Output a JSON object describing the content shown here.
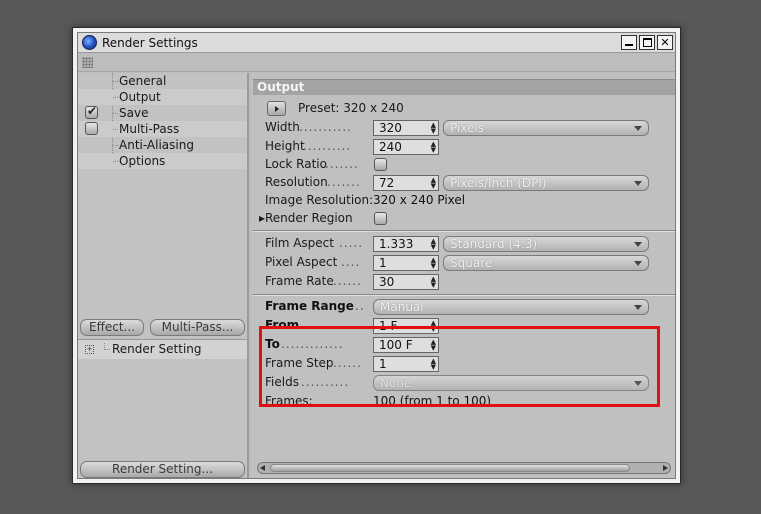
{
  "window": {
    "title": "Render Settings"
  },
  "tree": {
    "items": [
      {
        "label": "General"
      },
      {
        "label": "Output"
      },
      {
        "label": "Save"
      },
      {
        "label": "Multi-Pass"
      },
      {
        "label": "Anti-Aliasing"
      },
      {
        "label": "Options"
      }
    ]
  },
  "left_buttons": {
    "effect": "Effect...",
    "multipass": "Multi-Pass...",
    "render_setting": "Render Setting..."
  },
  "settings_list": {
    "item": "Render Setting"
  },
  "output": {
    "header": "Output",
    "preset": "Preset: 320 x 240",
    "width": {
      "label": "Width",
      "value": "320",
      "unit": "Pixels"
    },
    "height": {
      "label": "Height",
      "value": "240"
    },
    "lock_ratio": {
      "label": "Lock Ratio"
    },
    "resolution": {
      "label": "Resolution",
      "value": "72",
      "unit": "Pixels/Inch (DPI)"
    },
    "image_resolution": {
      "label": "Image Resolution:",
      "value": "320 x 240 Pixel"
    },
    "render_region": {
      "label": "Render Region"
    },
    "film_aspect": {
      "label": "Film Aspect",
      "value": "1.333",
      "preset": "Standard (4:3)"
    },
    "pixel_aspect": {
      "label": "Pixel Aspect",
      "value": "1",
      "preset": "Square"
    },
    "frame_rate": {
      "label": "Frame Rate",
      "value": "30"
    },
    "frame_range": {
      "label": "Frame Range",
      "value": "Manual"
    },
    "from": {
      "label": "From",
      "value": "1 F"
    },
    "to": {
      "label": "To",
      "value": "100 F"
    },
    "frame_step": {
      "label": "Frame Step",
      "value": "1"
    },
    "fields": {
      "label": "Fields",
      "value": "None"
    },
    "frames": {
      "label": "Frames:",
      "value": "100 (from 1 to 100)"
    }
  },
  "colors": {
    "highlight": "#e01010"
  }
}
